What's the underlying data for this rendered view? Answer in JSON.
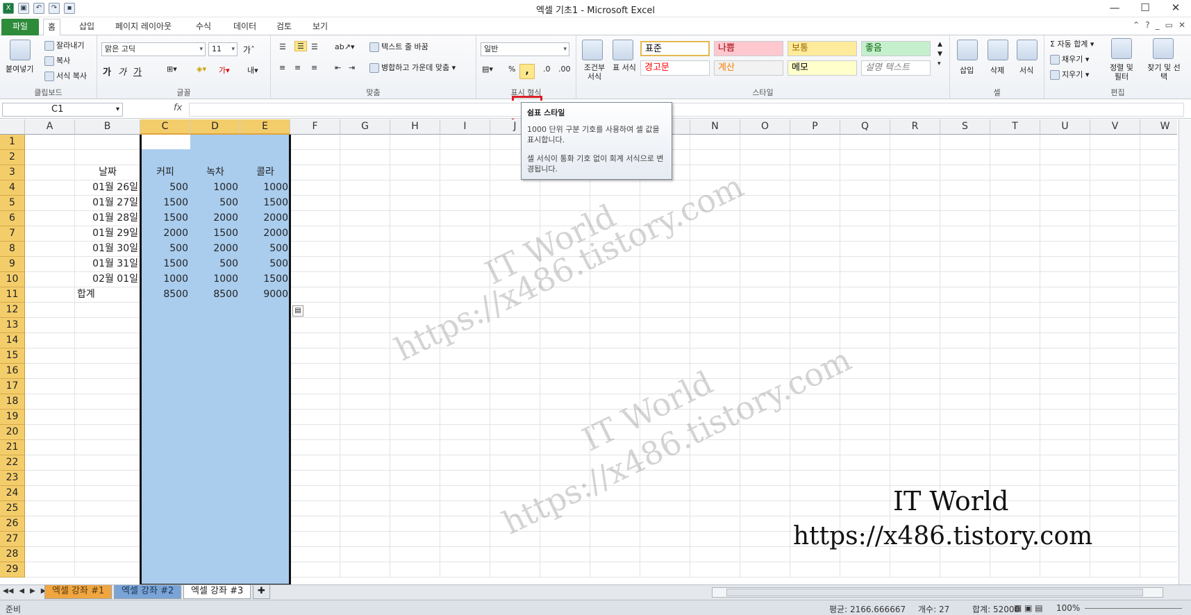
{
  "window": {
    "title": "엑셀 기초1  -  Microsoft Excel"
  },
  "tabs": [
    "파일",
    "홈",
    "삽입",
    "페이지 레이아웃",
    "수식",
    "데이터",
    "검토",
    "보기"
  ],
  "ribbon": {
    "clipboard": {
      "label": "클립보드",
      "paste": "붙여넣기",
      "cut": "잘라내기",
      "copy": "복사",
      "format_painter": "서식 복사"
    },
    "font": {
      "label": "글꼴",
      "font_name": "맑은 고딕",
      "font_size": "11",
      "bold": "가",
      "italic": "가",
      "underline": "가"
    },
    "alignment": {
      "label": "맞춤",
      "wrap_text": "텍스트 줄 바꿈",
      "merge_center": "병합하고 가운데 맞춤"
    },
    "number": {
      "label": "표시 형식",
      "format": "일반",
      "comma": ",",
      "percent": "%"
    },
    "styles": {
      "label": "스타일",
      "conditional": "조건부 서식",
      "table": "표 서식",
      "cells": [
        {
          "text": "표준",
          "bg": "#ffffff",
          "color": "#000000"
        },
        {
          "text": "나쁨",
          "bg": "#ffc7ce",
          "color": "#9c0006"
        },
        {
          "text": "보통",
          "bg": "#ffeb9c",
          "color": "#9c6500"
        },
        {
          "text": "좋음",
          "bg": "#c6efce",
          "color": "#006100"
        },
        {
          "text": "경고문",
          "bg": "#ffffff",
          "color": "#ff0000"
        },
        {
          "text": "계산",
          "bg": "#f2f2f2",
          "color": "#fa7d00"
        },
        {
          "text": "메모",
          "bg": "#ffffcc",
          "color": "#000000"
        },
        {
          "text": "설명 텍스트",
          "bg": "#ffffff",
          "color": "#7f7f7f"
        }
      ]
    },
    "cells": {
      "label": "셀",
      "insert": "삽입",
      "delete": "삭제",
      "format": "서식"
    },
    "editing": {
      "label": "편집",
      "autosum": "자동 합계",
      "fill": "채우기",
      "clear": "지우기",
      "sort": "정렬 및 필터",
      "find": "찾기 및 선택"
    }
  },
  "formula_bar": {
    "name_box": "C1",
    "fx": "fx",
    "value": ""
  },
  "tooltip": {
    "title": "쉼표 스타일",
    "line1": "1000 단위 구분 기호를 사용하여 셀 값을 표시합니다.",
    "line2": "셀 서식이 통화 기호 없이 회계 서식으로 변경됩니다."
  },
  "columns": [
    "A",
    "B",
    "C",
    "D",
    "E",
    "F",
    "G",
    "H",
    "I",
    "J",
    "K",
    "L",
    "M",
    "N",
    "O",
    "P",
    "Q",
    "R",
    "S",
    "T",
    "U",
    "V",
    "W"
  ],
  "rows": [
    "1",
    "2",
    "3",
    "4",
    "5",
    "6",
    "7",
    "8",
    "9",
    "10",
    "11",
    "12",
    "13",
    "14",
    "15",
    "16",
    "17",
    "18",
    "19",
    "20",
    "21",
    "22",
    "23",
    "24",
    "25",
    "26",
    "27",
    "28",
    "29"
  ],
  "table": {
    "headers": [
      "날짜",
      "커피",
      "녹차",
      "콜라"
    ],
    "rows": [
      [
        "01월 26일",
        "500",
        "1000",
        "1000"
      ],
      [
        "01월 27일",
        "1500",
        "500",
        "1500"
      ],
      [
        "01월 28일",
        "1500",
        "2000",
        "2000"
      ],
      [
        "01월 29일",
        "2000",
        "1500",
        "2000"
      ],
      [
        "01월 30일",
        "500",
        "2000",
        "500"
      ],
      [
        "01월 31일",
        "1500",
        "500",
        "500"
      ],
      [
        "02월 01일",
        "1000",
        "1000",
        "1500"
      ]
    ],
    "total": [
      "합계",
      "8500",
      "8500",
      "9000"
    ]
  },
  "watermark": {
    "name": "IT World",
    "url": "https://x486.tistory.com"
  },
  "sheets": [
    "엑셀 강좌 #1",
    "엑셀 강좌 #2",
    "엑셀 강좌 #3"
  ],
  "status": {
    "ready": "준비",
    "average": "평균: 2166.666667",
    "count": "개수: 27",
    "sum": "합계: 52000",
    "zoom": "100%"
  }
}
